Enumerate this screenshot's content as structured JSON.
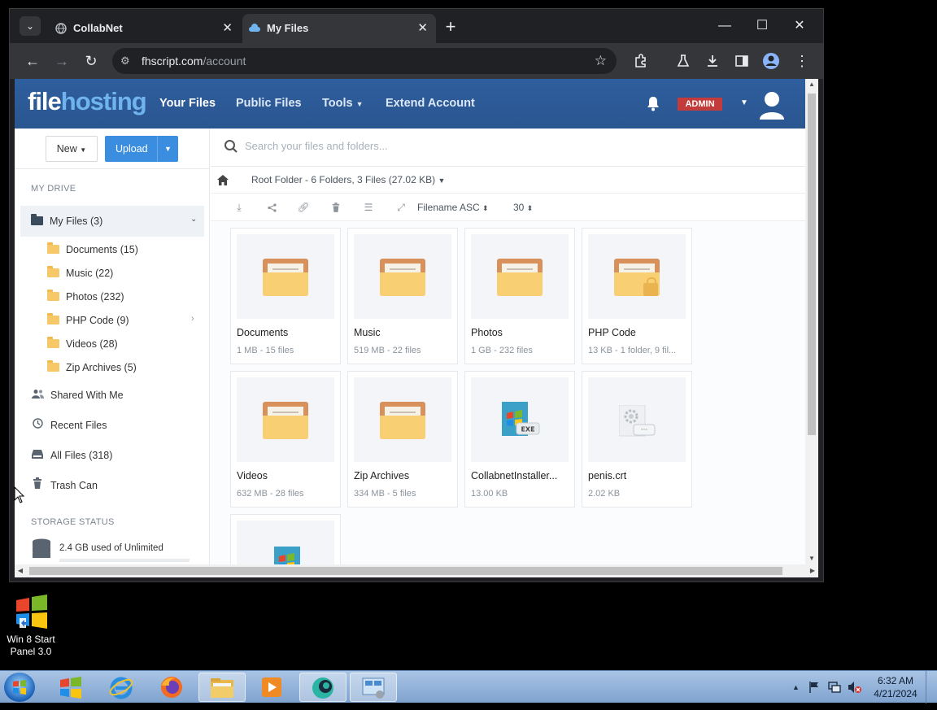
{
  "desktop": {
    "icon_label": "Win 8 Start Panel 3.0"
  },
  "browser": {
    "tabs": [
      {
        "label": "CollabNet",
        "close": "✕"
      },
      {
        "label": "My Files",
        "close": "✕"
      }
    ],
    "new_tab": "+",
    "window_controls": {
      "minimize": "—",
      "maximize": "☐",
      "close": "✕"
    },
    "toolbar": {
      "back": "←",
      "forward": "→",
      "reload": "↻"
    },
    "url_domain": "fhscript.com",
    "url_path": "/account"
  },
  "app": {
    "brand_main": "file",
    "brand_accent": "hosting",
    "nav": {
      "your_files": "Your Files",
      "public_files": "Public Files",
      "tools": "Tools",
      "extend": "Extend Account"
    },
    "admin_badge": "ADMIN",
    "colors": {
      "header": "#2b5797",
      "brand_accent": "#6fb3ef",
      "upload": "#3b8de0",
      "admin": "#c43b3b"
    }
  },
  "sidebar": {
    "new_label": "New",
    "upload_label": "Upload",
    "my_drive_heading": "MY DRIVE",
    "my_files": "My Files (3)",
    "folders": [
      {
        "label": "Documents (15)"
      },
      {
        "label": "Music (22)"
      },
      {
        "label": "Photos (232)"
      },
      {
        "label": "PHP Code (9)"
      },
      {
        "label": "Videos (28)"
      },
      {
        "label": "Zip Archives (5)"
      }
    ],
    "shared": "Shared With Me",
    "recent": "Recent Files",
    "all_files": "All Files (318)",
    "trash": "Trash Can",
    "storage_heading": "STORAGE STATUS",
    "storage_text": "2.4 GB used of Unlimited"
  },
  "main": {
    "search_placeholder": "Search your files and folders...",
    "breadcrumb": "Root Folder - 6 Folders, 3 Files (27.02 KB)",
    "sort": "Filename ASC",
    "per_page": "30",
    "items": [
      {
        "name": "Documents",
        "meta": "1 MB - 15 files"
      },
      {
        "name": "Music",
        "meta": "519 MB - 22 files"
      },
      {
        "name": "Photos",
        "meta": "1 GB - 232 files"
      },
      {
        "name": "PHP Code",
        "meta": "13 KB - 1 folder, 9 fil..."
      },
      {
        "name": "Videos",
        "meta": "632 MB - 28 files"
      },
      {
        "name": "Zip Archives",
        "meta": "334 MB - 5 files"
      },
      {
        "name": "CollabnetInstaller...",
        "meta": "13.00 KB"
      },
      {
        "name": "penis.crt",
        "meta": "2.02 KB"
      }
    ]
  },
  "taskbar": {
    "time": "6:32 AM",
    "date": "4/21/2024"
  }
}
